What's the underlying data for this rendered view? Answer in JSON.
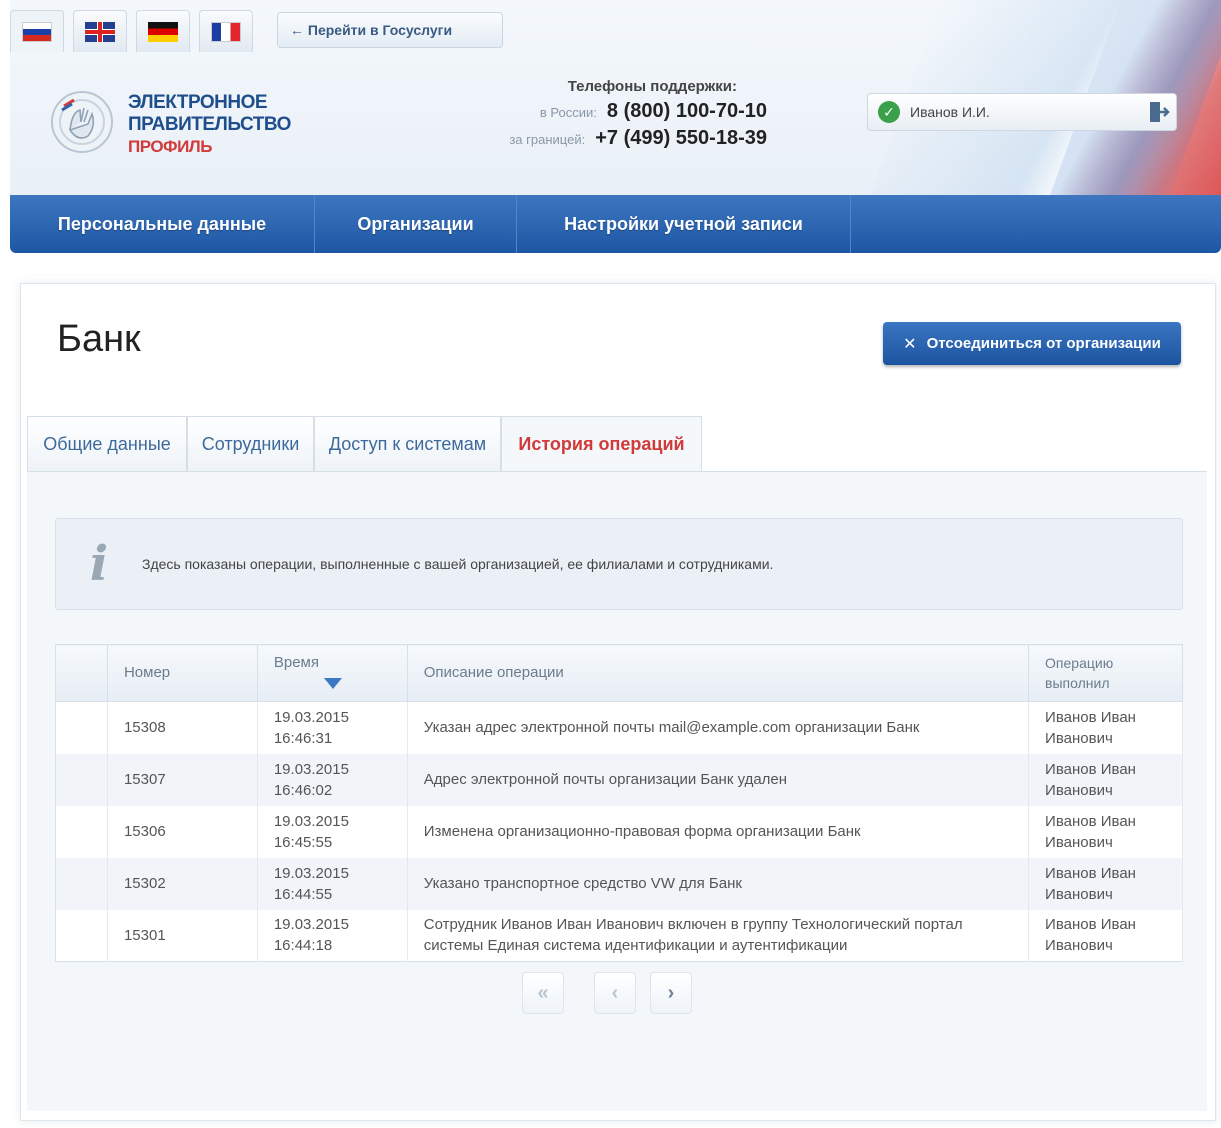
{
  "header": {
    "languages": [
      {
        "name": "ru-flag-icon"
      },
      {
        "name": "uk-flag-icon"
      },
      {
        "name": "de-flag-icon"
      },
      {
        "name": "fr-flag-icon"
      }
    ],
    "gosuslugi_link": "← Перейти в Госуслуги",
    "logo": {
      "line1": "ЭЛЕКТРОННОЕ",
      "line2": "ПРАВИТЕЛЬСТВО",
      "line3": "ПРОФИЛЬ"
    },
    "support": {
      "title": "Телефоны поддержки:",
      "russia_label": "в России:",
      "russia_phone": "8 (800) 100-70-10",
      "abroad_label": "за границей:",
      "abroad_phone": "+7 (499) 550-18-39"
    },
    "user_name": "Иванов И.И."
  },
  "nav": {
    "items": [
      {
        "label": "Персональные данные"
      },
      {
        "label": "Организации"
      },
      {
        "label": "Настройки учетной записи"
      }
    ]
  },
  "page": {
    "title": "Банк",
    "disconnect_button": "Отсоединиться от организации"
  },
  "tabs": [
    {
      "label": "Общие данные"
    },
    {
      "label": "Сотрудники"
    },
    {
      "label": "Доступ к системам"
    },
    {
      "label": "История операций",
      "active": true
    }
  ],
  "info": {
    "text": "Здесь показаны операции, выполненные с вашей организацией, ее филиалами и сотрудниками."
  },
  "table": {
    "headers": {
      "number": "Номер",
      "time": "Время",
      "description": "Описание операции",
      "performer": "Операцию выполнил"
    },
    "rows": [
      {
        "number": "15308",
        "date": "19.03.2015",
        "time": "16:46:31",
        "description": "Указан адрес электронной почты mail@example.com организации Банк",
        "performer1": "Иванов Иван",
        "performer2": "Иванович"
      },
      {
        "number": "15307",
        "date": "19.03.2015",
        "time": "16:46:02",
        "description": "Адрес электронной почты организации Банк удален",
        "performer1": "Иванов Иван",
        "performer2": "Иванович"
      },
      {
        "number": "15306",
        "date": "19.03.2015",
        "time": "16:45:55",
        "description": "Изменена организационно-правовая форма организации Банк",
        "performer1": "Иванов Иван",
        "performer2": "Иванович"
      },
      {
        "number": "15302",
        "date": "19.03.2015",
        "time": "16:44:55",
        "description": "Указано транспортное средство VW для Банк",
        "performer1": "Иванов Иван",
        "performer2": "Иванович"
      },
      {
        "number": "15301",
        "date": "19.03.2015",
        "time": "16:44:18",
        "description": "Сотрудник Иванов Иван Иванович включен в группу Технологический портал системы Единая система идентификации и аутентификации",
        "performer1": "Иванов Иван",
        "performer2": "Иванович"
      }
    ]
  },
  "pager": {
    "first": "«",
    "prev": "‹",
    "next": "›"
  },
  "colors": {
    "nav_blue": "#2a63ae",
    "accent_red": "#d13a3a",
    "link_blue": "#3d6a9b"
  }
}
